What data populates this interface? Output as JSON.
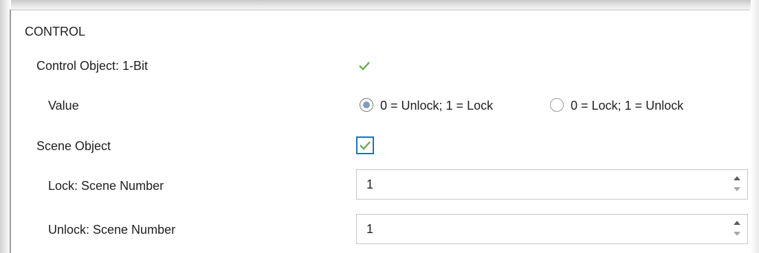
{
  "section": {
    "title": "CONTROL"
  },
  "rows": {
    "control_object": {
      "label": "Control Object: 1-Bit",
      "checked": true
    },
    "value": {
      "label": "Value",
      "options": [
        {
          "label": "0 = Unlock; 1 = Lock",
          "selected": true
        },
        {
          "label": "0 = Lock; 1 = Unlock",
          "selected": false
        }
      ]
    },
    "scene_object": {
      "label": "Scene Object",
      "checked": true
    },
    "lock_scene": {
      "label": "Lock: Scene Number",
      "value": "1"
    },
    "unlock_scene": {
      "label": "Unlock: Scene Number",
      "value": "1"
    }
  },
  "icons": {
    "check": "check-icon",
    "spin_up": "arrow-up-icon",
    "spin_down": "arrow-down-icon"
  },
  "colors": {
    "check": "#6aa84f",
    "focus_border": "#1f6fb5",
    "radio_dot": "#7f9cbc"
  }
}
